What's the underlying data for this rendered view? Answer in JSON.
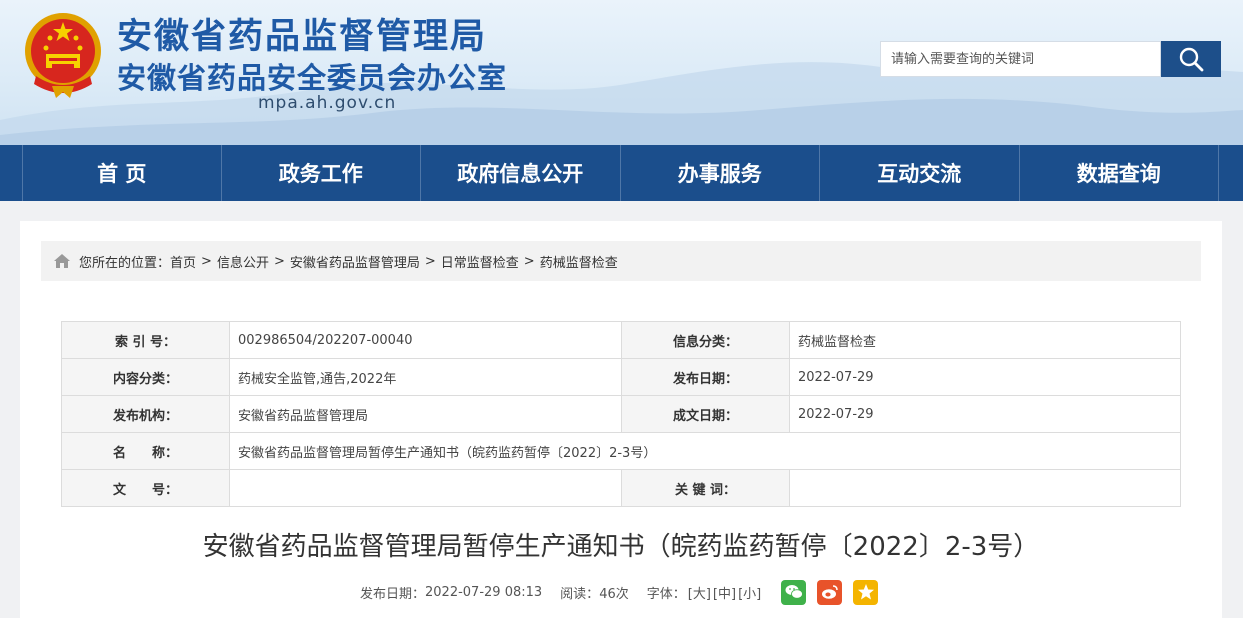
{
  "header": {
    "title_main": "安徽省药品监督管理局",
    "title_sub": "安徽省药品安全委员会办公室",
    "domain": "mpa.ah.gov.cn",
    "search_placeholder": "请输入需要查询的关键词"
  },
  "nav": {
    "items": [
      "首 页",
      "政务工作",
      "政府信息公开",
      "办事服务",
      "互动交流",
      "数据查询"
    ]
  },
  "breadcrumb": {
    "prefix": "您所在的位置：",
    "items": [
      "首页",
      "信息公开",
      "安徽省药品监督管理局",
      "日常监督检查",
      "药械监督检查"
    ],
    "separator": ">"
  },
  "info_table": {
    "rows": [
      {
        "label1": "索 引 号：",
        "value1": "002986504/202207-00040",
        "label2": "信息分类：",
        "value2": "药械监督检查"
      },
      {
        "label1": "内容分类：",
        "value1": "药械安全监管,通告,2022年",
        "label2": "发布日期：",
        "value2": "2022-07-29"
      },
      {
        "label1": "发布机构：",
        "value1": "安徽省药品监督管理局",
        "label2": "成文日期：",
        "value2": "2022-07-29"
      },
      {
        "label1": "名　　称：",
        "value1": "安徽省药品监督管理局暂停生产通知书（皖药监药暂停〔2022〕2-3号）"
      },
      {
        "label1": "文　　号：",
        "value1": "",
        "label2": "关 键 词：",
        "value2": ""
      }
    ]
  },
  "article": {
    "title": "安徽省药品监督管理局暂停生产通知书（皖药监药暂停〔2022〕2-3号）",
    "publish_label": "发布日期：",
    "publish_date": "2022-07-29 08:13",
    "read_label": "阅读：",
    "read_count": "46次",
    "font_label": "字体：",
    "font_large": "[大]",
    "font_medium": "[中]",
    "font_small": "[小]"
  },
  "icons": {
    "search": "search-icon",
    "home": "home-icon",
    "wechat": "wechat-icon",
    "weibo": "weibo-icon",
    "qzone": "qzone-icon"
  },
  "colors": {
    "brand_blue": "#1b4e8c",
    "title_blue": "#1f5aa6"
  }
}
